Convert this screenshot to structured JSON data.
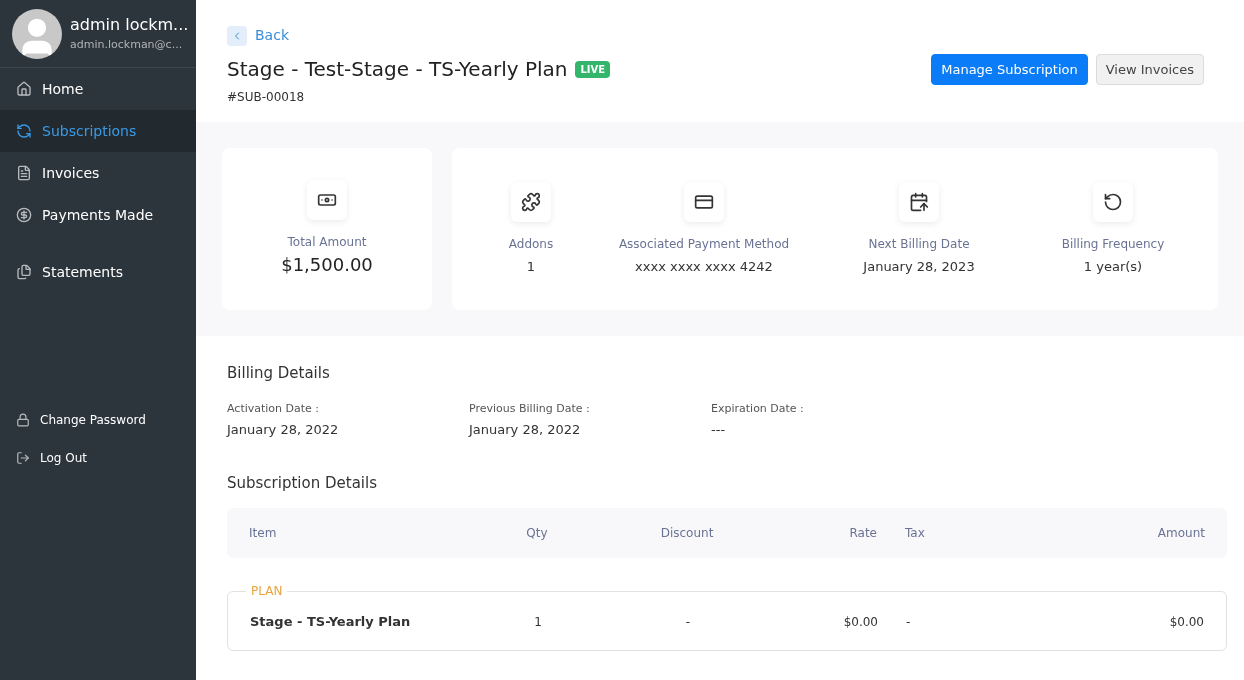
{
  "user": {
    "name": "admin lockm...",
    "email": "admin.lockman@c..."
  },
  "nav": [
    {
      "kind": "home",
      "label": "Home",
      "selected": false
    },
    {
      "kind": "subscriptions",
      "label": "Subscriptions",
      "selected": true
    },
    {
      "kind": "invoices",
      "label": "Invoices",
      "selected": false
    },
    {
      "kind": "payments",
      "label": "Payments Made",
      "selected": false
    },
    {
      "kind": "statements",
      "label": "Statements",
      "selected": false
    }
  ],
  "account_links": [
    {
      "kind": "password",
      "label": "Change Password"
    },
    {
      "kind": "logout",
      "label": "Log Out"
    }
  ],
  "back": "Back",
  "title": "Stage - Test-Stage - TS-Yearly Plan",
  "status": "LIVE",
  "subscription_id": "#SUB-00018",
  "buttons": [
    {
      "label": "Manage Subscription",
      "kind": "primary"
    },
    {
      "label": "View Invoices",
      "kind": "secondary"
    }
  ],
  "total": {
    "label": "Total Amount",
    "value": "$1,500.00"
  },
  "stats": [
    {
      "kind": "addons",
      "label": "Addons",
      "value": "1"
    },
    {
      "kind": "card",
      "label": "Associated Payment Method",
      "value": "xxxx xxxx xxxx 4242"
    },
    {
      "kind": "calendar",
      "label": "Next Billing Date",
      "value": "January 28, 2023"
    },
    {
      "kind": "frequency",
      "label": "Billing Frequency",
      "value": "1 year(s)"
    }
  ],
  "billing": {
    "title": "Billing Details",
    "fields": [
      {
        "label": "Activation Date :",
        "value": "January 28, 2022"
      },
      {
        "label": "Previous Billing Date :",
        "value": "January 28, 2022"
      },
      {
        "label": "Expiration Date :",
        "value": "---"
      }
    ]
  },
  "subscription": {
    "title": "Subscription Details",
    "columns": [
      "Item",
      "Qty",
      "Discount",
      "Rate",
      "Tax",
      "Amount"
    ],
    "group": "PLAN",
    "rows": [
      {
        "item": "Stage - TS-Yearly Plan",
        "qty": "1",
        "discount": "-",
        "rate": "$0.00",
        "tax": "-",
        "amount": "$0.00"
      }
    ]
  }
}
